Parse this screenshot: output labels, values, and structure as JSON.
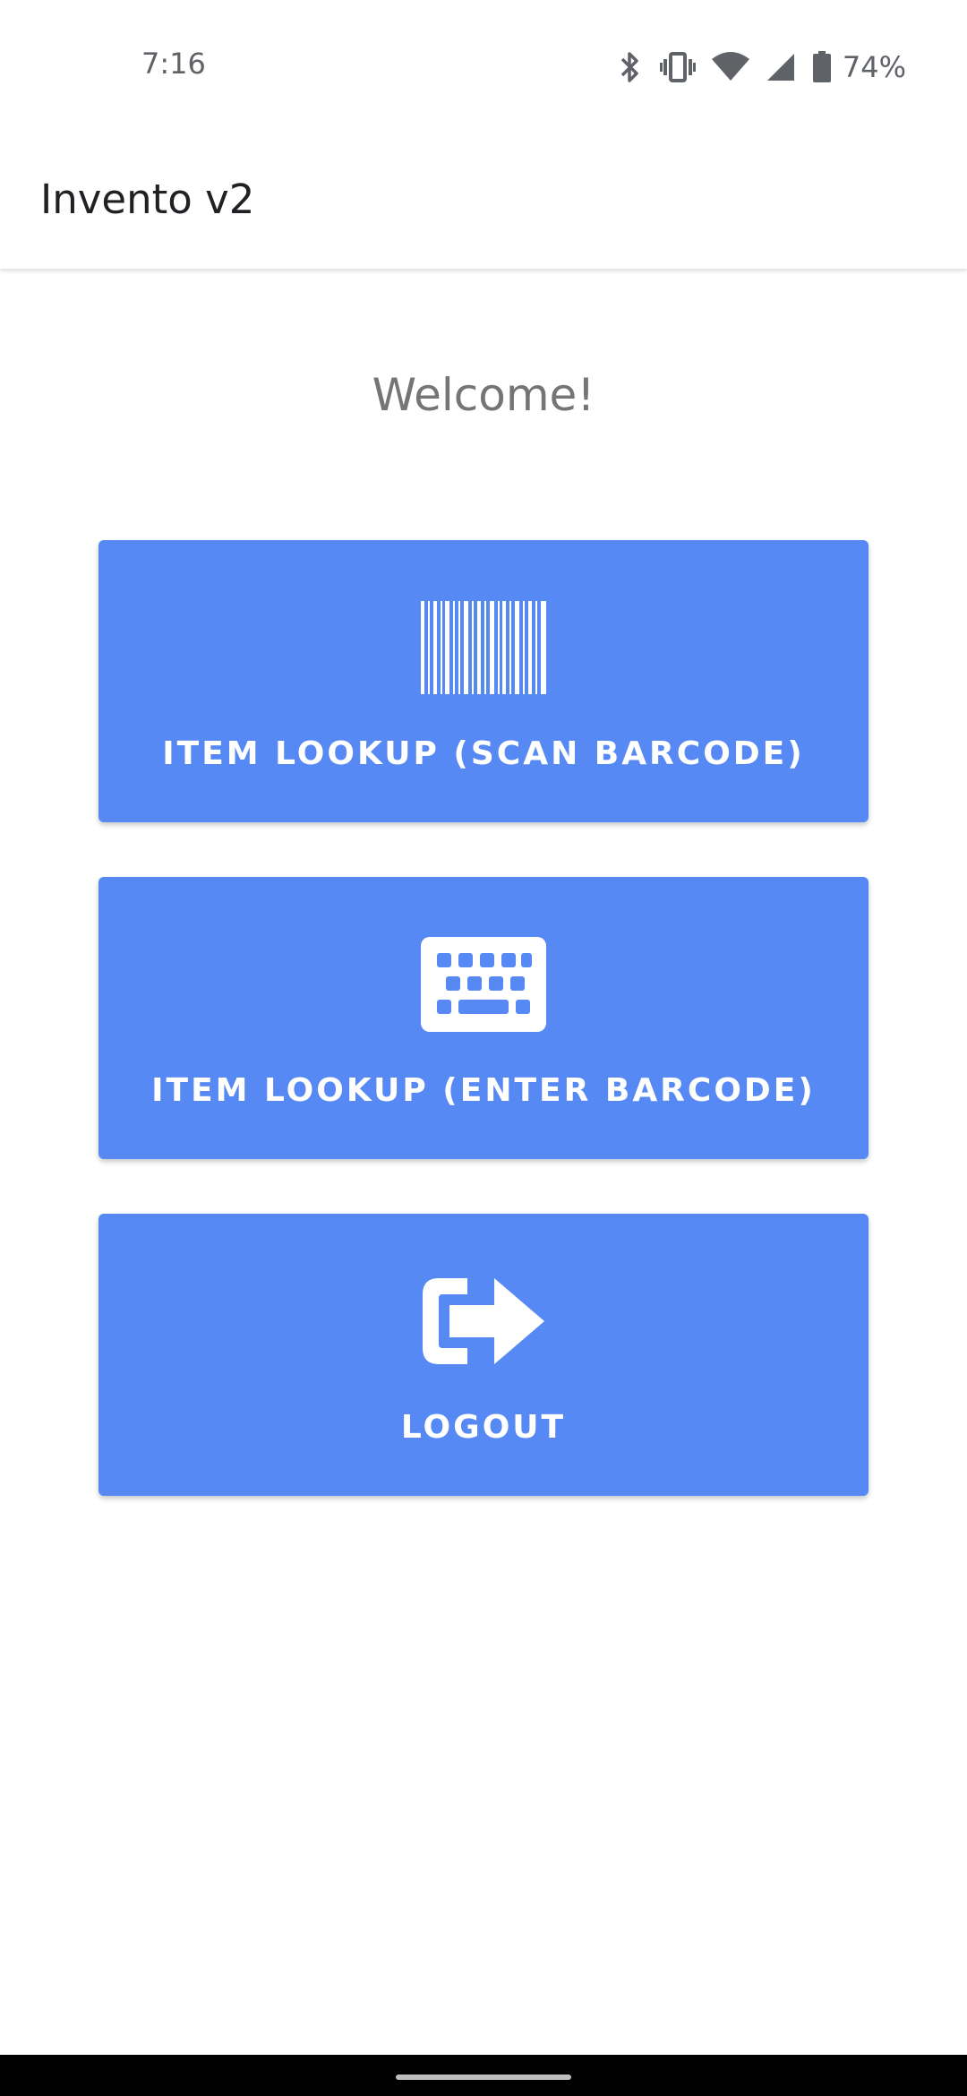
{
  "status_bar": {
    "time": "7:16",
    "battery_percent": "74%",
    "icons": [
      "bluetooth-icon",
      "vibrate-icon",
      "wifi-icon",
      "cell-signal-icon",
      "battery-icon"
    ]
  },
  "app_bar": {
    "title": "Invento v2"
  },
  "main": {
    "welcome": "Welcome!",
    "buttons": [
      {
        "label": "ITEM LOOKUP (SCAN BARCODE)",
        "icon": "barcode-icon"
      },
      {
        "label": "ITEM LOOKUP (ENTER BARCODE)",
        "icon": "keyboard-icon"
      },
      {
        "label": "LOGOUT",
        "icon": "logout-icon"
      }
    ]
  },
  "colors": {
    "accent": "#5789f4",
    "button_text": "#ffffff",
    "welcome_text": "#757575"
  }
}
